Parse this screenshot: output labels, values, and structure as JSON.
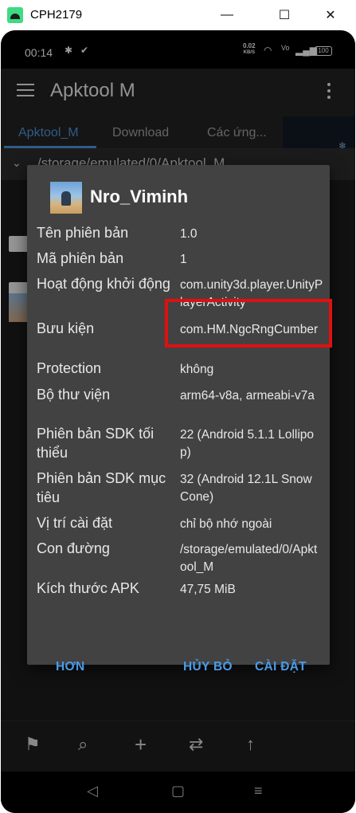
{
  "window": {
    "title": "CPH2179",
    "minimize_glyph": "—",
    "maximize_glyph": "☐",
    "close_glyph": "✕"
  },
  "status_bar": {
    "time": "00:14",
    "net_speed_value": "0.02",
    "net_speed_unit": "KB/S",
    "battery": "100"
  },
  "app_bar": {
    "title": "Apktool M"
  },
  "tabs": [
    {
      "label": "Apktool_M"
    },
    {
      "label": "Download"
    },
    {
      "label": "Các ứng..."
    }
  ],
  "path": "/storage/emulated/0/Apktool_M",
  "dialog": {
    "title": "Nro_Viminh",
    "rows": [
      {
        "label": "Tên phiên bản",
        "value": "1.0"
      },
      {
        "label": "Mã phiên bản",
        "value": "1"
      },
      {
        "label": "Hoạt động khởi động",
        "value": "com.unity3d.player.UnityPlayerActivity"
      },
      {
        "label": "Bưu kiện",
        "value": "com.HM.NgcRngCumber"
      },
      {
        "label": "Protection",
        "value": "không"
      },
      {
        "label": "Bộ thư viện",
        "value": "arm64-v8a, armeabi-v7a"
      },
      {
        "label": "Phiên bản SDK tối thiểu",
        "value": "22 (Android 5.1.1 Lollipop)"
      },
      {
        "label": "Phiên bản SDK mục tiêu",
        "value": "32 (Android 12.1L Snow Cone)"
      },
      {
        "label": "Vị trí cài đặt",
        "value": "chỉ bộ nhớ ngoài"
      },
      {
        "label": "Con đường",
        "value": "/storage/emulated/0/Apktool_M"
      },
      {
        "label": "Kích thước APK",
        "value": "47,75 MiB"
      }
    ],
    "buttons": {
      "more": "HƠN",
      "cancel": "HỦY BỎ",
      "install": "CÀI ĐẶT"
    }
  },
  "icons": {
    "toolbar": [
      "bookmark-icon",
      "search-icon",
      "add-icon",
      "swap-icon",
      "arrow-up-icon"
    ],
    "nav": [
      "back-icon",
      "home-icon",
      "recents-icon"
    ]
  },
  "colors": {
    "accent": "#4a9be8",
    "highlight_border": "#e01010",
    "dialog_bg": "#424242"
  }
}
